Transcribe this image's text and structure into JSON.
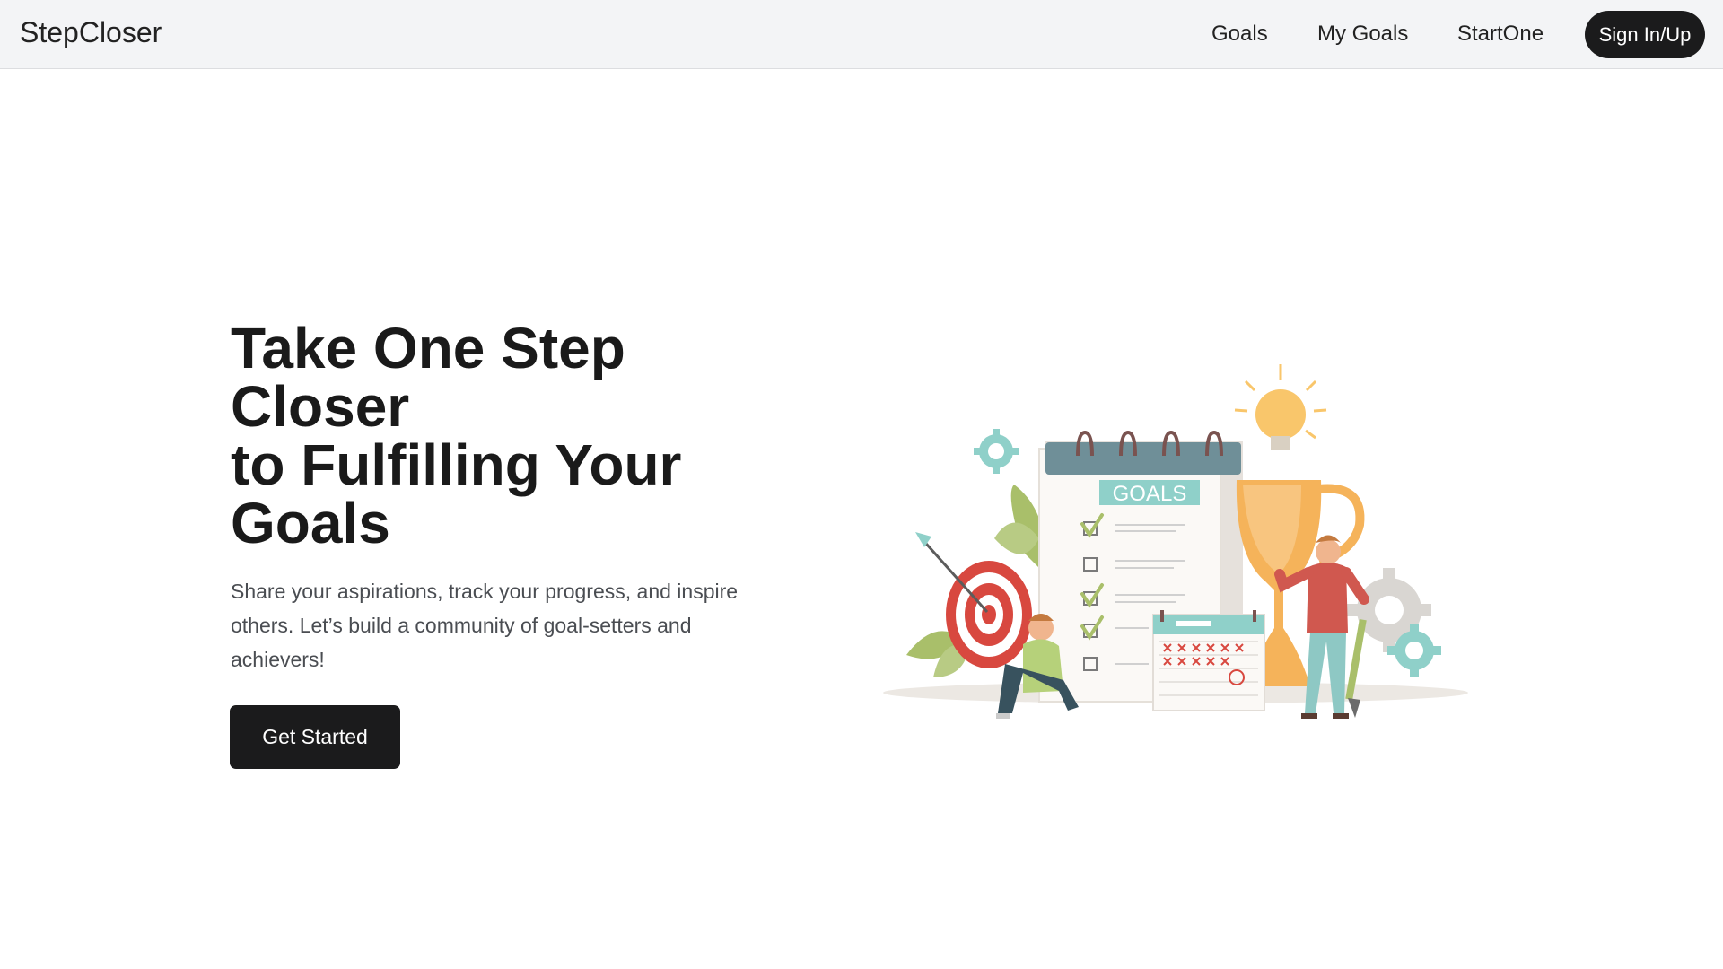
{
  "nav": {
    "brand": "StepCloser",
    "links": [
      "Goals",
      "My Goals",
      "StartOne"
    ],
    "signin_label": "Sign In/Up"
  },
  "hero": {
    "title_lines": [
      "Take One Step",
      "Closer",
      "to Fulfilling Your",
      "Goals"
    ],
    "description": "Share your aspirations, track your progress, and inspire others. Let’s build a community of goal-setters and achievers!",
    "cta_label": "Get Started"
  },
  "illustration": {
    "banner_text": "GOALS",
    "colors": {
      "teal": "#8fd0c9",
      "slate": "#6f8f98",
      "gold": "#f5b35a",
      "red": "#d8483f",
      "leaf": "#a9bf6a",
      "gear": "#d9d6d2"
    }
  },
  "colors": {
    "navbar_bg": "#f3f4f6",
    "button_bg": "#1b1b1c",
    "text_dark": "#1a1a1a",
    "text_muted": "#4a4d52"
  }
}
